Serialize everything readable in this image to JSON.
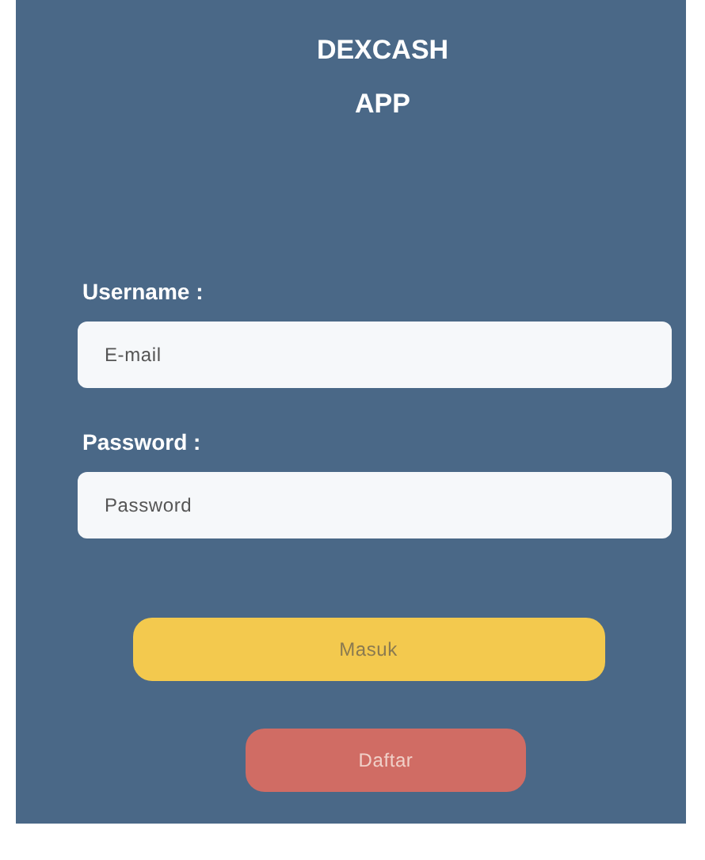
{
  "title_lines": [
    "DEXCASH",
    "APP"
  ],
  "fields": [
    {
      "label": "Username :",
      "placeholder": "E-mail"
    },
    {
      "label": "Password :",
      "placeholder": "Password"
    }
  ],
  "buttons": [
    {
      "label": "Masuk",
      "kind": "primary"
    },
    {
      "label": "Daftar",
      "kind": "secondary"
    }
  ]
}
